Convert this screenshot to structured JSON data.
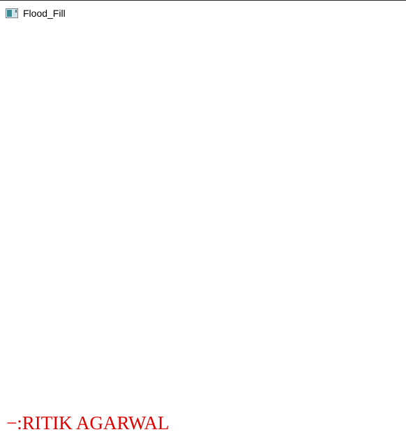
{
  "window": {
    "title": "Flood_Fill",
    "icon": "app-window-icon"
  },
  "canvas": {
    "rectangle": {
      "edges": {
        "top": "#00d000",
        "left_top": "#00d000",
        "right": "#0000cc",
        "bottom": "#e00000",
        "left_bottom": "#e00000"
      }
    },
    "credit_text": "−:RITIK AGARWAL",
    "credit_color": "#e00000"
  }
}
